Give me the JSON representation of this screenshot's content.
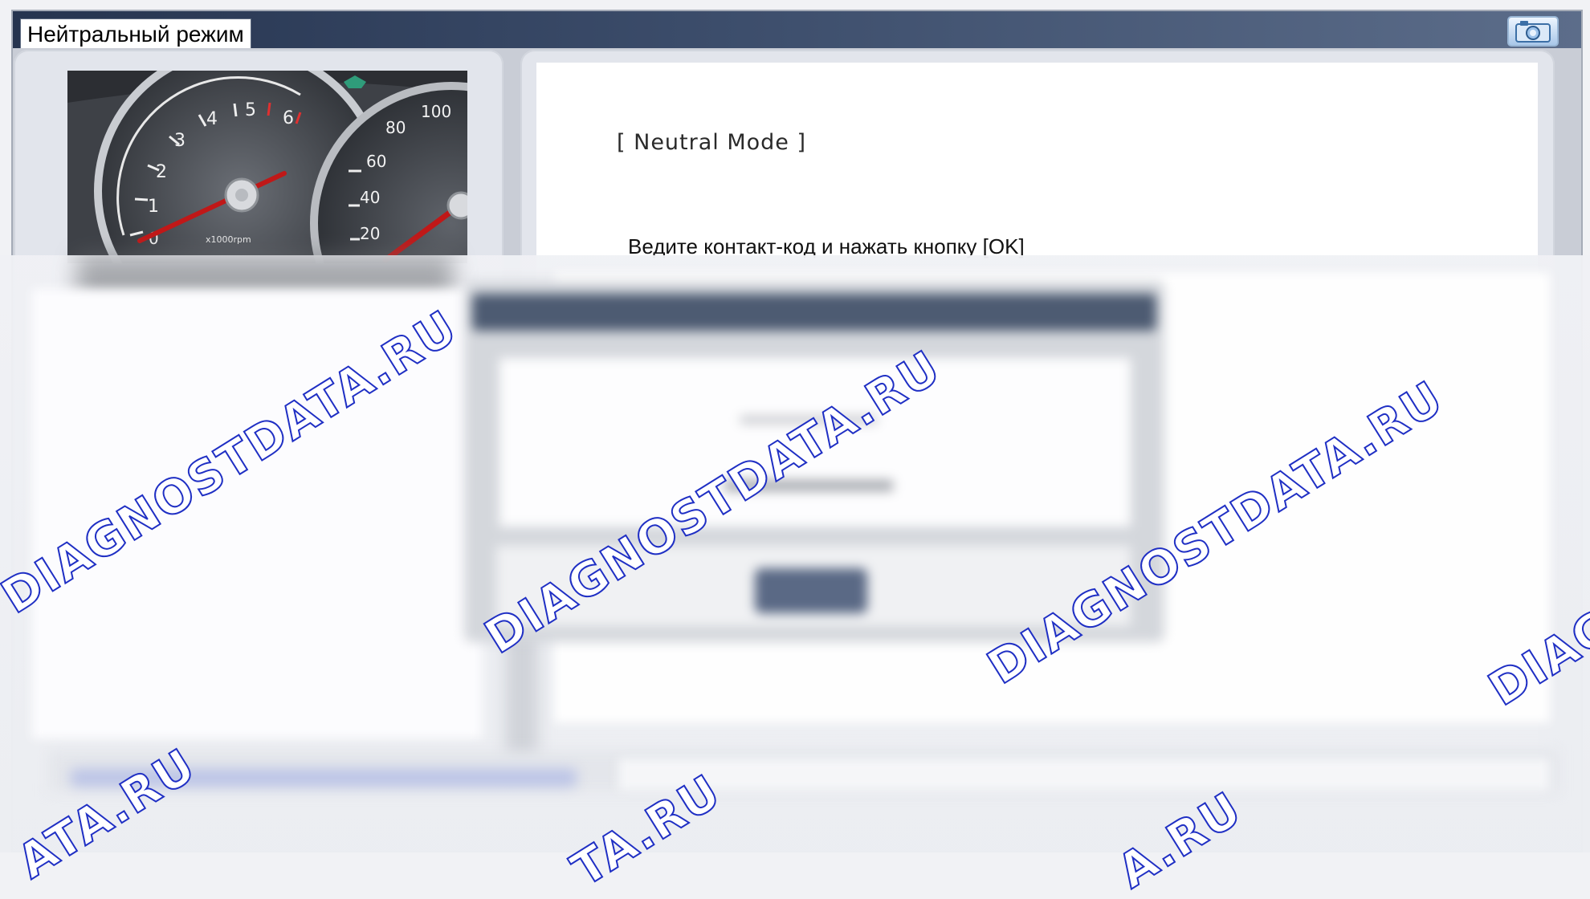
{
  "window": {
    "title": "Нейтральный режим",
    "camera_icon": "camera-icon"
  },
  "gauge": {
    "tach_numbers": [
      "1",
      "2",
      "3",
      "4",
      "5",
      "6"
    ],
    "tach_zero": "0",
    "tach_unit": "x1000rpm",
    "speed_numbers": [
      "100",
      "80",
      "60",
      "40",
      "20"
    ]
  },
  "main": {
    "header": "[ Neutral Mode ]",
    "instruction": "Ведите контакт-код и нажать кнопку [OK]"
  },
  "watermark": {
    "text": "DIAGNOSTDATA.RU",
    "fragments": [
      "DIAG",
      "ATA.RU",
      "TA.RU",
      "A.RU"
    ]
  },
  "colors": {
    "titlebar": "#26344f",
    "watermark_stroke": "#1f2fc4",
    "needle": "#c01818"
  }
}
